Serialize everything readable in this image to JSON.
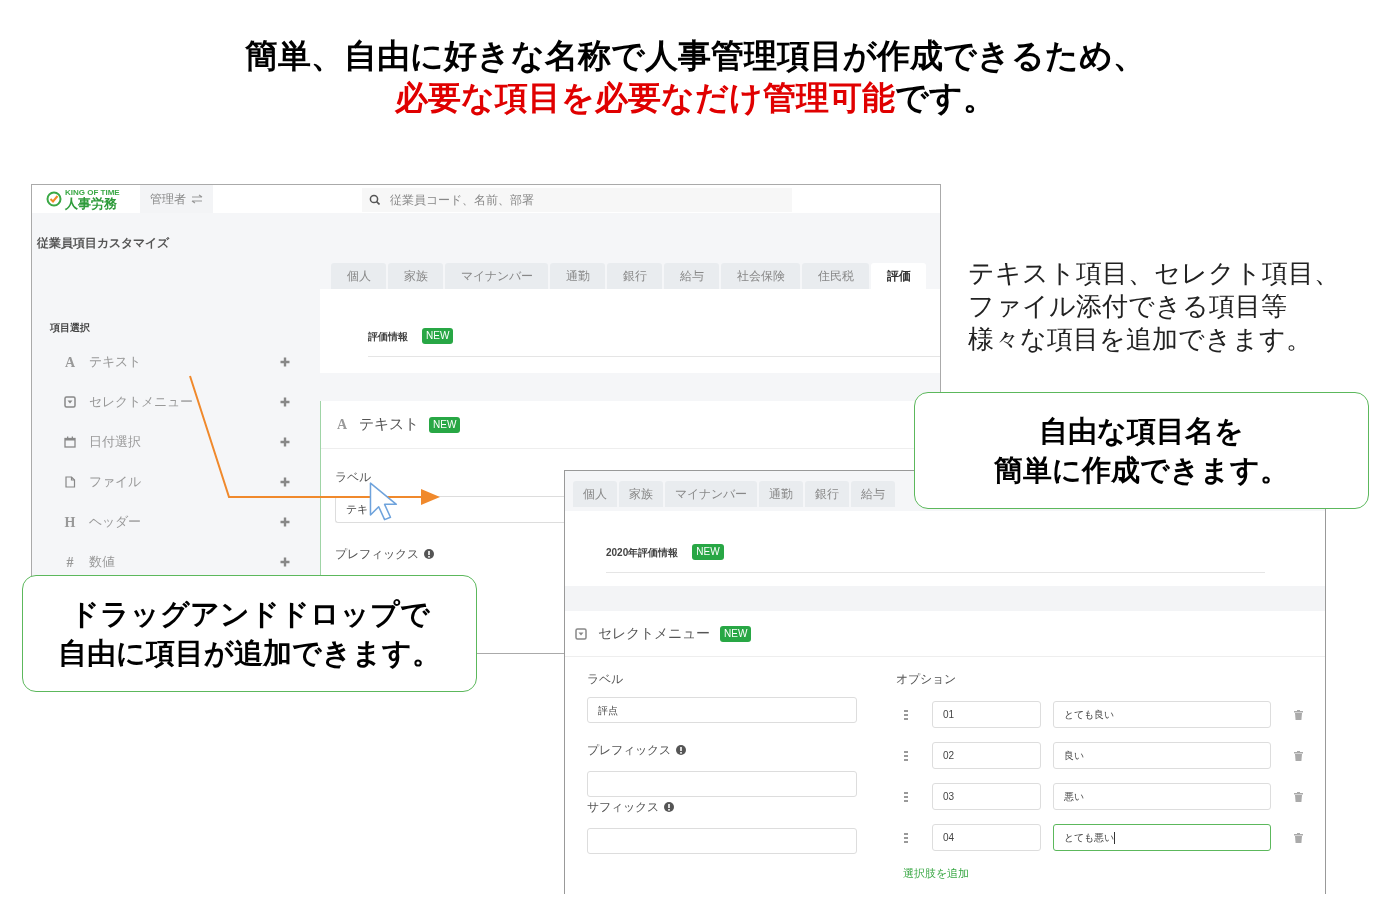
{
  "headline": {
    "line1": "簡単、自由に好きな名称で人事管理項目が作成できるため、",
    "line2_highlight": "必要な項目を必要なだけ管理可能",
    "line2_rest": "です。"
  },
  "admin_window": {
    "logo_small": "KING OF TIME",
    "logo_text": "人事労務",
    "role_button": "管理者",
    "search": {
      "placeholder": "従業員コード、名前、部署"
    },
    "page_title": "従業員項目カスタマイズ",
    "tabs": [
      {
        "label": "個人",
        "selected": false
      },
      {
        "label": "家族",
        "selected": false
      },
      {
        "label": "マイナンバー",
        "selected": false
      },
      {
        "label": "通勤",
        "selected": false
      },
      {
        "label": "銀行",
        "selected": false
      },
      {
        "label": "給与",
        "selected": false
      },
      {
        "label": "社会保険",
        "selected": false
      },
      {
        "label": "住民税",
        "selected": false
      },
      {
        "label": "評価",
        "selected": true
      }
    ],
    "section": {
      "title": "評価情報",
      "badge": "NEW"
    },
    "palette": {
      "title": "項目選択",
      "items": [
        {
          "kind": "text",
          "glyph": "A",
          "label": "テキスト"
        },
        {
          "kind": "select",
          "label": "セレクトメニュー"
        },
        {
          "kind": "date",
          "label": "日付選択"
        },
        {
          "kind": "file",
          "label": "ファイル"
        },
        {
          "kind": "header",
          "glyph": "H",
          "label": "ヘッダー"
        },
        {
          "kind": "number",
          "glyph": "#",
          "label": "数値"
        }
      ]
    },
    "new_field": {
      "glyph": "A",
      "title": "テキスト",
      "badge": "NEW",
      "label_caption": "ラベル",
      "label_value": "テキ",
      "prefix_caption": "プレフィックス"
    }
  },
  "detail_window": {
    "tabs": [
      {
        "label": "個人",
        "selected": false
      },
      {
        "label": "家族",
        "selected": false
      },
      {
        "label": "マイナンバー",
        "selected": false
      },
      {
        "label": "通勤",
        "selected": false
      },
      {
        "label": "銀行",
        "selected": false
      },
      {
        "label": "給与",
        "selected": false
      }
    ],
    "section": {
      "title": "2020年評価情報",
      "badge": "NEW"
    },
    "field": {
      "title": "セレクトメニュー",
      "badge": "NEW",
      "label_caption": "ラベル",
      "label_value": "評点",
      "prefix_caption": "プレフィックス",
      "suffix_caption": "サフィックス",
      "options_caption": "オプション",
      "options": [
        {
          "code": "01",
          "label": "とても良い",
          "focused": false
        },
        {
          "code": "02",
          "label": "良い",
          "focused": false
        },
        {
          "code": "03",
          "label": "悪い",
          "focused": false
        },
        {
          "code": "04",
          "label": "とても悪い",
          "focused": true
        }
      ],
      "add_option": "選択肢を追加"
    }
  },
  "note": [
    "テキスト項目、セレクト項目、",
    "ファイル添付できる項目等",
    "様々な項目を追加できます。"
  ],
  "callouts": [
    {
      "lines": [
        "自由な項目名を",
        "簡単に作成できます。"
      ]
    },
    {
      "lines": [
        "ドラッグアンドドロップで",
        "自由に項目が追加できます。"
      ]
    }
  ]
}
